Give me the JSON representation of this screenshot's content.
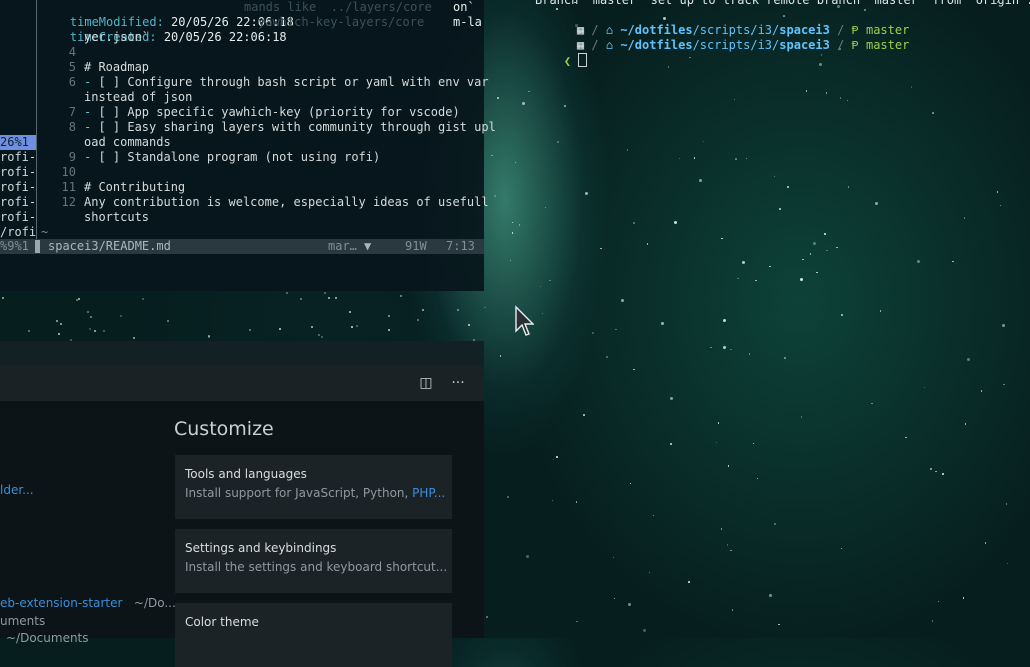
{
  "vim": {
    "header_lines": [
      {
        "key": "timeModified:",
        "value": " 20/05/26 22:06:18"
      },
      {
        "key": "timeCreated:",
        "value": " 20/05/26 22:06:18"
      }
    ],
    "header_ghost": [
      "mands like  ../layers/core",
      "yawhich-key-layers/core"
    ],
    "header_right": [
      "on`",
      "m-la"
    ],
    "left_column": [
      "",
      "",
      "",
      "",
      "",
      "",
      "",
      "",
      "",
      "26%1",
      "rofi-w",
      "rofi-w",
      "rofi-w",
      "rofi-w",
      "rofi-w",
      "/rofi"
    ],
    "lines": [
      {
        "num": "",
        "text": "yer.json`"
      },
      {
        "num": "4",
        "text": ""
      },
      {
        "num": "5",
        "text": "# Roadmap"
      },
      {
        "num": "6",
        "dash": "- ",
        "text": "[ ] Configure through bash script or yaml with env var"
      },
      {
        "num": "",
        "text": "instead of json"
      },
      {
        "num": "7",
        "dash": "- ",
        "text": "[ ] App specific yawhich-key (priority for vscode)"
      },
      {
        "num": "8",
        "dash": "- ",
        "text": "[ ] Easy sharing layers with community through gist upl"
      },
      {
        "num": "",
        "text": "oad commands"
      },
      {
        "num": "9",
        "dash": "- ",
        "text": "[ ] Standalone program (not using rofi)"
      },
      {
        "num": "10",
        "text": ""
      },
      {
        "num": "11",
        "text": "# Contributing"
      },
      {
        "num": "12",
        "text": "Any contribution is welcome, especially ideas of usefull"
      },
      {
        "num": "",
        "text": "shortcuts"
      }
    ],
    "tilde": "~",
    "status": {
      "left": "%9%1",
      "file": "spacei3/README.md",
      "mode": "mar…",
      "words": "91W",
      "pos": "7:13"
    }
  },
  "terminal": {
    "top_line": "Branch 'master' set up to track remote branch 'master' from 'origin'.",
    "prompt_rows": [
      {
        "tilde": "~/",
        "dir1": "dotfiles",
        "sep": "/scripts/i3/",
        "dir2": "spacei3",
        "branch": "master"
      },
      {
        "tilde": "~/",
        "dir1": "dotfiles",
        "sep": "/scripts/i3/",
        "dir2": "spacei3",
        "branch": "master"
      }
    ],
    "prompt_char": "❮"
  },
  "vscode": {
    "section_title": "Customize",
    "cards": [
      {
        "title": "Tools and languages",
        "desc": "Install support for JavaScript, Python, ",
        "link": "PHP..."
      },
      {
        "title": "Settings and keybindings",
        "desc": "Install the settings and keyboard shortcut...",
        "link": ""
      },
      {
        "title": "Color theme",
        "desc": "",
        "link": ""
      }
    ],
    "recent": [
      {
        "name": "lder...",
        "path": ""
      },
      {
        "name": "eb-extension-starter",
        "path": "~/Do..."
      },
      {
        "name": "uments",
        "path": ""
      },
      {
        "name": "",
        "path": "~/Documents"
      }
    ],
    "toolbar": {
      "split_icon": "split-editor-icon",
      "more_icon": "more-actions-icon"
    }
  },
  "colors": {
    "accent_blue": "#3b8ed8",
    "terminal_path": "#5ec3ff",
    "terminal_branch": "#9ad04a",
    "vim_heading": "#4fb6c9"
  }
}
